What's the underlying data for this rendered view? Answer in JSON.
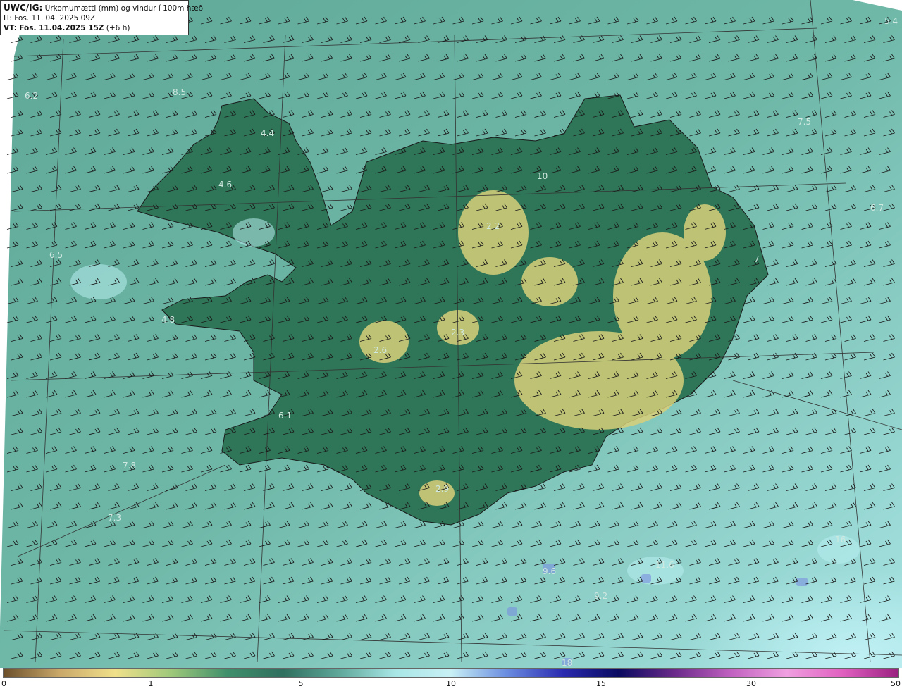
{
  "header": {
    "product": "UWC/IG:",
    "description": "Úrkomumætti (mm) og vindur í 100m hæð",
    "init_label": "IT:",
    "init_time": "Fös. 11. 04. 2025 09Z",
    "valid_label": "VT:",
    "valid_time": "Fös. 11.04.2025 15Z",
    "lead": "(+6 h)"
  },
  "map_labels": [
    {
      "id": "v54",
      "text": "5.4"
    },
    {
      "id": "v62",
      "text": "6.2"
    },
    {
      "id": "v85",
      "text": "8.5"
    },
    {
      "id": "v44",
      "text": "4.4"
    },
    {
      "id": "v46",
      "text": "4.6"
    },
    {
      "id": "v75",
      "text": "7.5"
    },
    {
      "id": "v67",
      "text": "6.7"
    },
    {
      "id": "v65",
      "text": "6.5"
    },
    {
      "id": "v48",
      "text": "4.8"
    },
    {
      "id": "v26",
      "text": "2.6"
    },
    {
      "id": "v23",
      "text": "2.3"
    },
    {
      "id": "v22",
      "text": "2.2"
    },
    {
      "id": "v78",
      "text": "7.8"
    },
    {
      "id": "v73",
      "text": "7.3"
    },
    {
      "id": "v29",
      "text": "2.9"
    },
    {
      "id": "v100",
      "text": "10"
    },
    {
      "id": "v7",
      "text": "7"
    },
    {
      "id": "v61",
      "text": "6.1"
    },
    {
      "id": "v16",
      "text": "16"
    },
    {
      "id": "v116",
      "text": "11.6"
    },
    {
      "id": "v96",
      "text": "9.6"
    },
    {
      "id": "v92",
      "text": "9.2"
    },
    {
      "id": "v18",
      "text": "18"
    }
  ],
  "colorbar": {
    "ticks": [
      "0",
      "1",
      "5",
      "10",
      "15",
      "30",
      "50"
    ],
    "stops": [
      "#6b4f2a",
      "#c9a86a",
      "#f0e08a",
      "#9ec87a",
      "#3f8f6b",
      "#2f6f5f",
      "#5fa89a",
      "#a8e6e6",
      "#c8f0f5",
      "#6a8ce0",
      "#2a2ab0",
      "#0a0a60",
      "#6a2a8a",
      "#c060c0",
      "#f0a0e0",
      "#e060c0",
      "#9a2080"
    ],
    "land_color": "#2a6a50",
    "sea_color": "#6fb4a6",
    "highlight_color": "#d8d07a"
  }
}
